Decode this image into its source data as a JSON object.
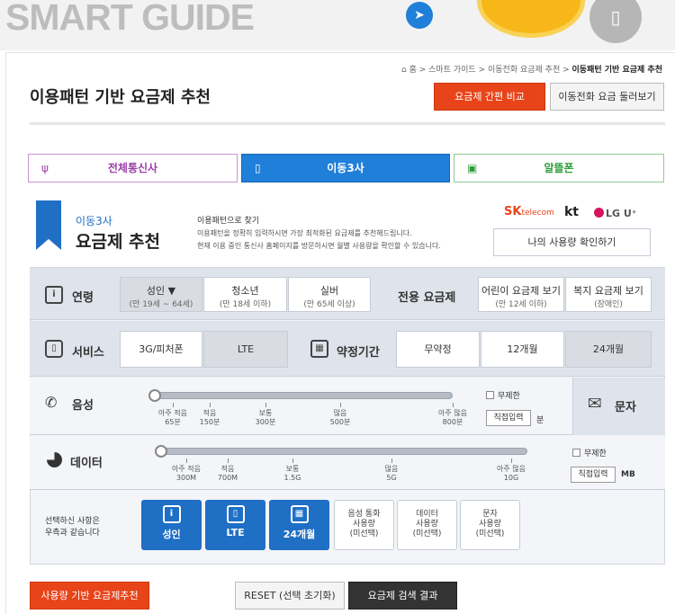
{
  "header": {
    "brand": "SMART GUIDE"
  },
  "breadcrumb": {
    "home": "홈",
    "items": [
      "스마트 가이드",
      "이동전화 요금제 추천"
    ],
    "current": "이동패턴 기반 요금제 추천"
  },
  "page": {
    "title": "이용패턴 기반 요금제 추천",
    "compare_button": "요금제 간편 비교",
    "browse_button": "이동전화 요금 둘러보기"
  },
  "tabs": [
    {
      "label": "전체통신사"
    },
    {
      "label": "이동3사"
    },
    {
      "label": "알뜰폰"
    }
  ],
  "banner": {
    "small": "이동3사",
    "big": "요금제 추천",
    "desc_title": "이용패턴으로 찾기",
    "desc_1": "이용패턴을 정확히 입력하시면 가장 최적화된 요금제를 추천해드립니다.",
    "desc_2": "현재 이용 중인 통신사 홈페이지를 방문하시면 월별 사용량을 확인할 수 있습니다.",
    "my_usage_button": "나의 사용량 확인하기",
    "carriers": {
      "sk": "SK",
      "sk_sub": "telecom",
      "kt": "kt",
      "lg": "LG U⁺"
    }
  },
  "age": {
    "label": "연령",
    "options": [
      {
        "label": "성인 ▼",
        "sub": "(만 19세 ~ 64세)"
      },
      {
        "label": "청소년",
        "sub": "(만 18세 이하)"
      },
      {
        "label": "실버",
        "sub": "(만 65세 이상)"
      }
    ],
    "special_label": "전용 요금제",
    "special": [
      {
        "label": "어린이 요금제 보기",
        "sub": "(만 12세 이하)"
      },
      {
        "label": "복지 요금제 보기",
        "sub": "(장애인)"
      }
    ]
  },
  "service": {
    "label": "서비스",
    "options": [
      "3G/피처폰",
      "LTE"
    ]
  },
  "contract": {
    "label": "약정기간",
    "options": [
      "무약정",
      "12개월",
      "24개월"
    ]
  },
  "voice": {
    "label": "음성",
    "ticks": [
      {
        "l1": "아주 적음",
        "l2": "65분"
      },
      {
        "l1": "적음",
        "l2": "150분"
      },
      {
        "l1": "보통",
        "l2": "300분"
      },
      {
        "l1": "많음",
        "l2": "500분"
      },
      {
        "l1": "아주 많음",
        "l2": "800분"
      }
    ],
    "unlimited": "무제한",
    "direct": "직접입력",
    "unit": "분"
  },
  "sms": {
    "label": "문자"
  },
  "data_usage": {
    "label": "데이터",
    "ticks": [
      {
        "l1": "아주 적음",
        "l2": "300M"
      },
      {
        "l1": "적음",
        "l2": "700M"
      },
      {
        "l1": "보통",
        "l2": "1.5G"
      },
      {
        "l1": "많음",
        "l2": "5G"
      },
      {
        "l1": "아주 많음",
        "l2": "10G"
      }
    ],
    "unlimited": "무제한",
    "direct": "직접입력",
    "unit": "MB"
  },
  "summary": {
    "label_1": "선택하신 사항은",
    "label_2": "우측과 같습니다",
    "chips": [
      "성인",
      "LTE",
      "24개월"
    ],
    "unselected": [
      {
        "l1": "음성 통화",
        "l2": "사용량",
        "l3": "(미선택)"
      },
      {
        "l1": "데이터",
        "l2": "사용량",
        "l3": "(미선택)"
      },
      {
        "l1": "문자",
        "l2": "사용량",
        "l3": "(미선택)"
      }
    ]
  },
  "bottom": {
    "usage_button": "사용량 기반 요금제추천",
    "reset_button": "RESET (선택 초기화)",
    "search_button": "요금제 검색 결과"
  }
}
